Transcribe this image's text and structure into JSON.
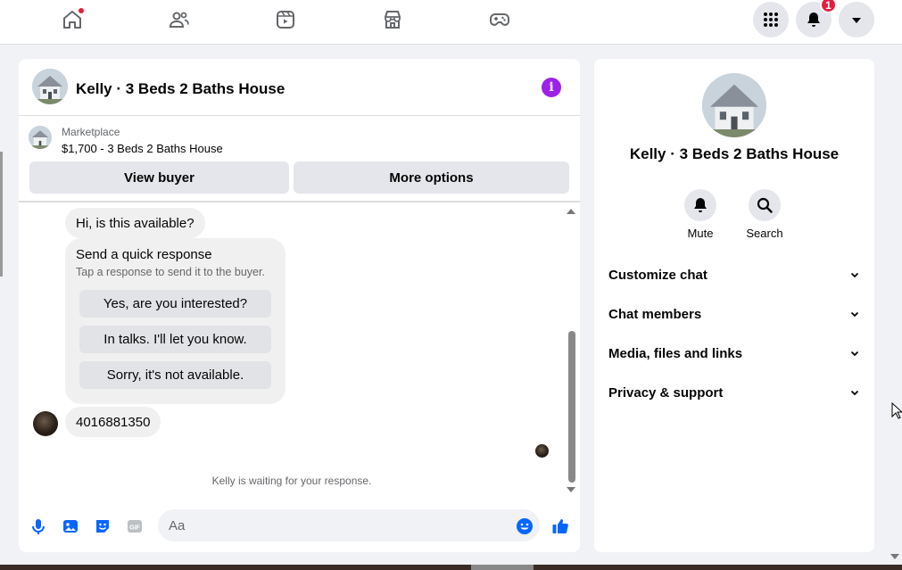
{
  "topnav": {
    "notification_count": "1"
  },
  "chat": {
    "title": "Kelly · 3 Beds 2 Baths House",
    "info_icon": "i",
    "marketplace_label": "Marketplace",
    "listing": "$1,700 - 3 Beds 2 Baths House",
    "view_buyer": "View buyer",
    "more_options": "More options",
    "messages": {
      "incoming": "Hi, is this available?",
      "quick_title": "Send a quick response",
      "quick_subtitle": "Tap a response to send it to the buyer.",
      "quick_options": [
        "Yes, are you interested?",
        "In talks. I'll let you know.",
        "Sorry, it's not available."
      ],
      "phone": "4016881350",
      "waiting": "Kelly is waiting for your response."
    },
    "composer": {
      "placeholder": "Aa",
      "gif_label": "GIF"
    }
  },
  "panel": {
    "title": "Kelly · 3 Beds 2 Baths House",
    "actions": [
      "Mute",
      "Search"
    ],
    "sections": [
      "Customize chat",
      "Chat members",
      "Media, files and links",
      "Privacy & support"
    ]
  },
  "colors": {
    "accent_blue": "#0866ff",
    "info_purple": "#9d21e6",
    "badge_red": "#e41e3f"
  },
  "icons": [
    "home-icon",
    "friends-icon",
    "video-icon",
    "marketplace-icon",
    "gaming-icon",
    "menu-grid-icon",
    "bell-icon",
    "caret-down-icon",
    "info-icon",
    "mic-icon",
    "photo-icon",
    "sticker-icon",
    "gif-icon",
    "emoji-icon",
    "like-icon",
    "search-icon",
    "chevron-down-icon"
  ]
}
